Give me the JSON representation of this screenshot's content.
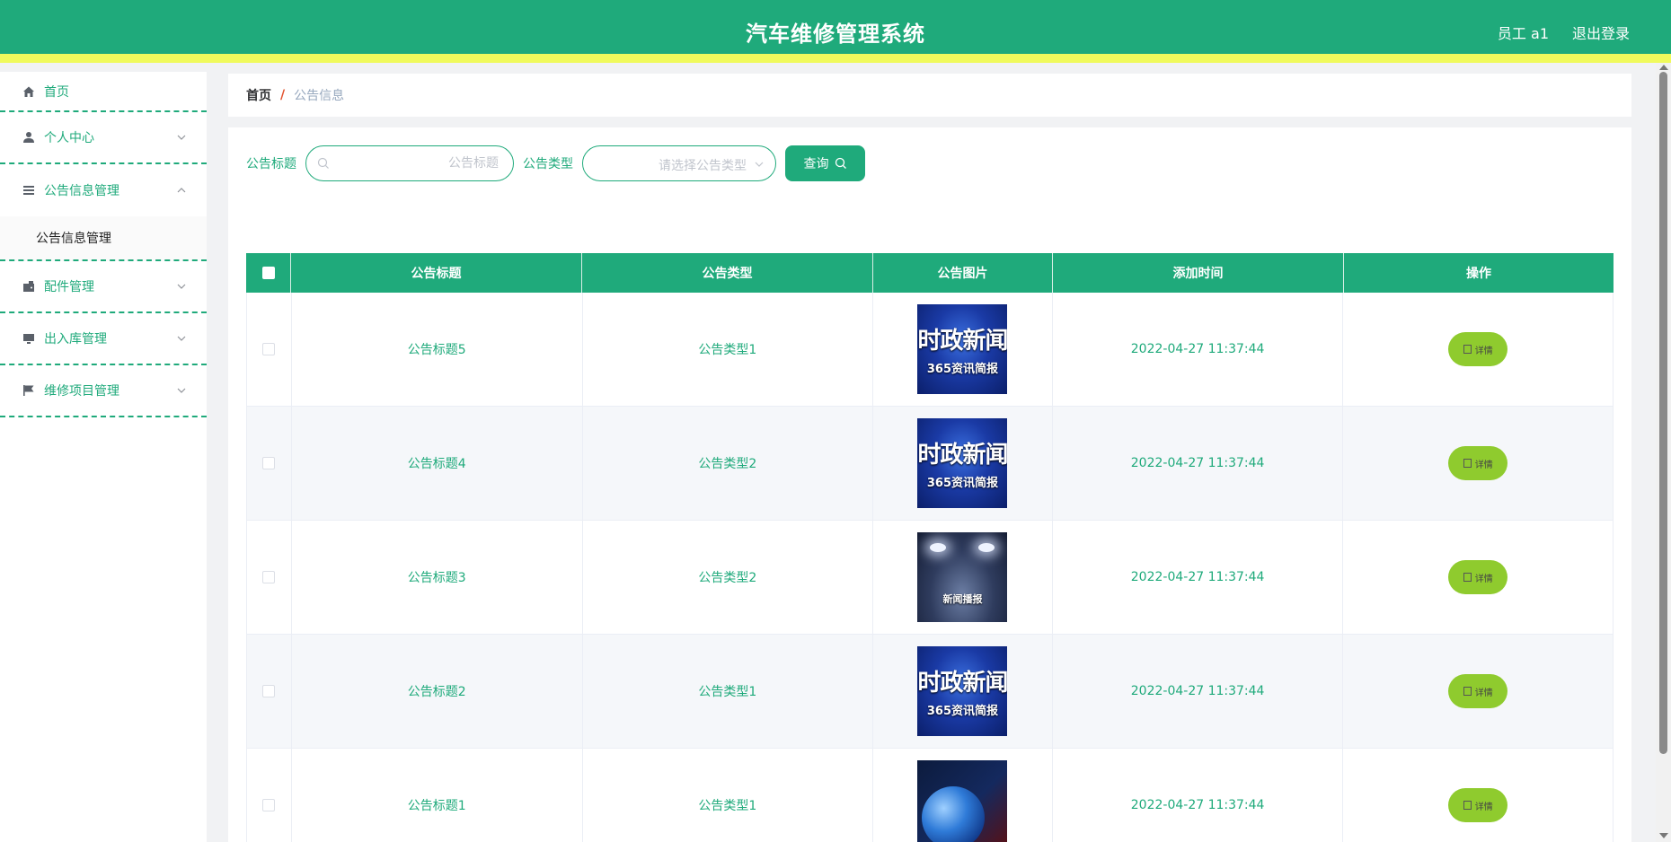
{
  "header": {
    "title": "汽车维修管理系统",
    "user": "员工 a1",
    "logout": "退出登录",
    "bg_color": "#1faa7b",
    "accent_stripe": "#f0fa5c"
  },
  "sidebar": {
    "items": [
      {
        "label": "首页",
        "icon": "home-icon"
      },
      {
        "label": "个人中心",
        "icon": "user-icon"
      },
      {
        "label": "公告信息管理",
        "icon": "list-icon",
        "open": true,
        "sub": "公告信息管理"
      },
      {
        "label": "配件管理",
        "icon": "wallet-icon"
      },
      {
        "label": "出入库管理",
        "icon": "monitor-icon"
      },
      {
        "label": "维修项目管理",
        "icon": "flag-icon"
      }
    ]
  },
  "breadcrumb": {
    "home": "首页",
    "sep": "/",
    "current": "公告信息"
  },
  "search": {
    "title_label": "公告标题",
    "title_placeholder": "公告标题",
    "type_label": "公告类型",
    "type_placeholder": "请选择公告类型",
    "query_button": "查询"
  },
  "table": {
    "headers": [
      "公告标题",
      "公告类型",
      "公告图片",
      "添加时间",
      "操作"
    ],
    "rows": [
      {
        "title": "公告标题5",
        "type": "公告类型1",
        "image": "时政新闻",
        "time": "2022-04-27 11:37:44",
        "op": "详情"
      },
      {
        "title": "公告标题4",
        "type": "公告类型2",
        "image": "时政新闻",
        "time": "2022-04-27 11:37:44",
        "op": "详情"
      },
      {
        "title": "公告标题3",
        "type": "公告类型2",
        "image": "新闻播报",
        "time": "2022-04-27 11:37:44",
        "op": "详情"
      },
      {
        "title": "公告标题2",
        "type": "公告类型1",
        "image": "时政新闻",
        "time": "2022-04-27 11:37:44",
        "op": "详情"
      },
      {
        "title": "公告标题1",
        "type": "公告类型1",
        "image": "globe",
        "time": "2022-04-27 11:37:44",
        "op": "详情"
      }
    ],
    "image_caption": "365资讯简报"
  }
}
